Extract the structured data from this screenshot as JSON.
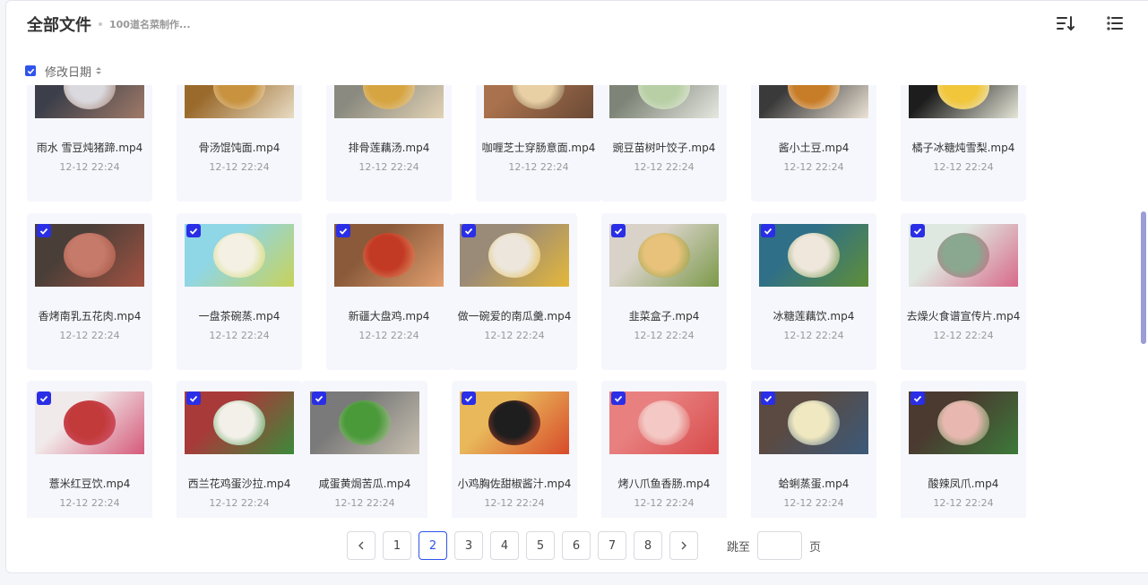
{
  "header": {
    "title": "全部文件",
    "crumb": "100道名菜制作..."
  },
  "sort": {
    "label": "修改日期"
  },
  "rows": [
    [
      {
        "name": "雨水 雪豆炖猪蹄.mp4",
        "date": "12-12 22:24",
        "checked": false,
        "colors": [
          "#3c3f4a",
          "#d9d9de",
          "#a07a68"
        ]
      },
      {
        "name": "骨汤馄饨面.mp4",
        "date": "12-12 22:24",
        "checked": false,
        "colors": [
          "#9a6a2c",
          "#c8923f",
          "#e8dcc4"
        ]
      },
      {
        "name": "排骨莲藕汤.mp4",
        "date": "12-12 22:24",
        "checked": false,
        "colors": [
          "#8a8a80",
          "#d6a440",
          "#e2d2b4"
        ]
      },
      {
        "name": "咖喱芝士穿肠意面.mp4",
        "date": "12-12 22:24",
        "checked": false,
        "colors": [
          "#a9714d",
          "#e8cfa4",
          "#6a4a36"
        ]
      },
      {
        "name": "豌豆苗树叶饺子.mp4",
        "date": "12-12 22:24",
        "checked": false,
        "colors": [
          "#7e8478",
          "#b8cfa5",
          "#e6e8e0"
        ]
      },
      {
        "name": "酱小土豆.mp4",
        "date": "12-12 22:24",
        "checked": false,
        "colors": [
          "#3a3a3a",
          "#c77c27",
          "#ede4d6"
        ]
      },
      {
        "name": "橘子冰糖炖雪梨.mp4",
        "date": "12-12 22:24",
        "checked": false,
        "colors": [
          "#1d1d1d",
          "#f2c63a",
          "#e6e7d8"
        ]
      }
    ],
    [
      {
        "name": "香烤南乳五花肉.mp4",
        "date": "12-12 22:24",
        "checked": true,
        "colors": [
          "#4a3f38",
          "#c57a6a",
          "#a35242"
        ]
      },
      {
        "name": "一盘茶碗蒸.mp4",
        "date": "12-12 22:24",
        "checked": true,
        "colors": [
          "#8fd6e6",
          "#f4f1e4",
          "#c8d25a"
        ]
      },
      {
        "name": "新疆大盘鸡.mp4",
        "date": "12-12 22:24",
        "checked": true,
        "colors": [
          "#8a5a3a",
          "#c23a24",
          "#e2a070"
        ]
      },
      {
        "name": "做一碗爱的南瓜羹.mp4",
        "date": "12-12 22:24",
        "checked": true,
        "colors": [
          "#9a8a78",
          "#ece6dc",
          "#e4b83a"
        ]
      },
      {
        "name": "韭菜盒子.mp4",
        "date": "12-12 22:24",
        "checked": true,
        "colors": [
          "#d8d2c8",
          "#e8c27a",
          "#7c9a4a"
        ]
      },
      {
        "name": "冰糖莲藕饮.mp4",
        "date": "12-12 22:24",
        "checked": true,
        "colors": [
          "#2f6f88",
          "#efe6dc",
          "#5f8f38"
        ]
      },
      {
        "name": "去燥火食谱宣传片.mp4",
        "date": "12-12 22:24",
        "checked": true,
        "colors": [
          "#dfe8e0",
          "#8aa890",
          "#d86a8a"
        ]
      }
    ],
    [
      {
        "name": "薏米红豆饮.mp4",
        "date": "12-12 22:24",
        "checked": true,
        "colors": [
          "#f1eaea",
          "#c23a3a",
          "#d55a7a"
        ]
      },
      {
        "name": "西兰花鸡蛋沙拉.mp4",
        "date": "12-12 22:24",
        "checked": true,
        "colors": [
          "#a83a3a",
          "#f2f0e8",
          "#3c8a3a"
        ]
      },
      {
        "name": "咸蛋黄焗苦瓜.mp4",
        "date": "12-12 22:24",
        "checked": true,
        "colors": [
          "#7a7a7a",
          "#4a9a3a",
          "#c8c0b0"
        ]
      },
      {
        "name": "小鸡胸佐甜椒酱汁.mp4",
        "date": "12-12 22:24",
        "checked": true,
        "colors": [
          "#e8b85a",
          "#1e1e1e",
          "#d84a2a"
        ]
      },
      {
        "name": "烤八爪鱼香肠.mp4",
        "date": "12-12 22:24",
        "checked": true,
        "colors": [
          "#e88080",
          "#f4c8c4",
          "#d84a4a"
        ]
      },
      {
        "name": "蛤蜊蒸蛋.mp4",
        "date": "12-12 22:24",
        "checked": true,
        "colors": [
          "#5a4a42",
          "#f0e8c0",
          "#3c5a7a"
        ]
      },
      {
        "name": "酸辣凤爪.mp4",
        "date": "12-12 22:24",
        "checked": true,
        "colors": [
          "#4a3a30",
          "#e8b8b0",
          "#3c7a3a"
        ]
      }
    ]
  ],
  "pagination": {
    "pages": [
      "1",
      "2",
      "3",
      "4",
      "5",
      "6",
      "7",
      "8"
    ],
    "current": "2",
    "jump_label": "跳至",
    "page_suffix": "页"
  }
}
